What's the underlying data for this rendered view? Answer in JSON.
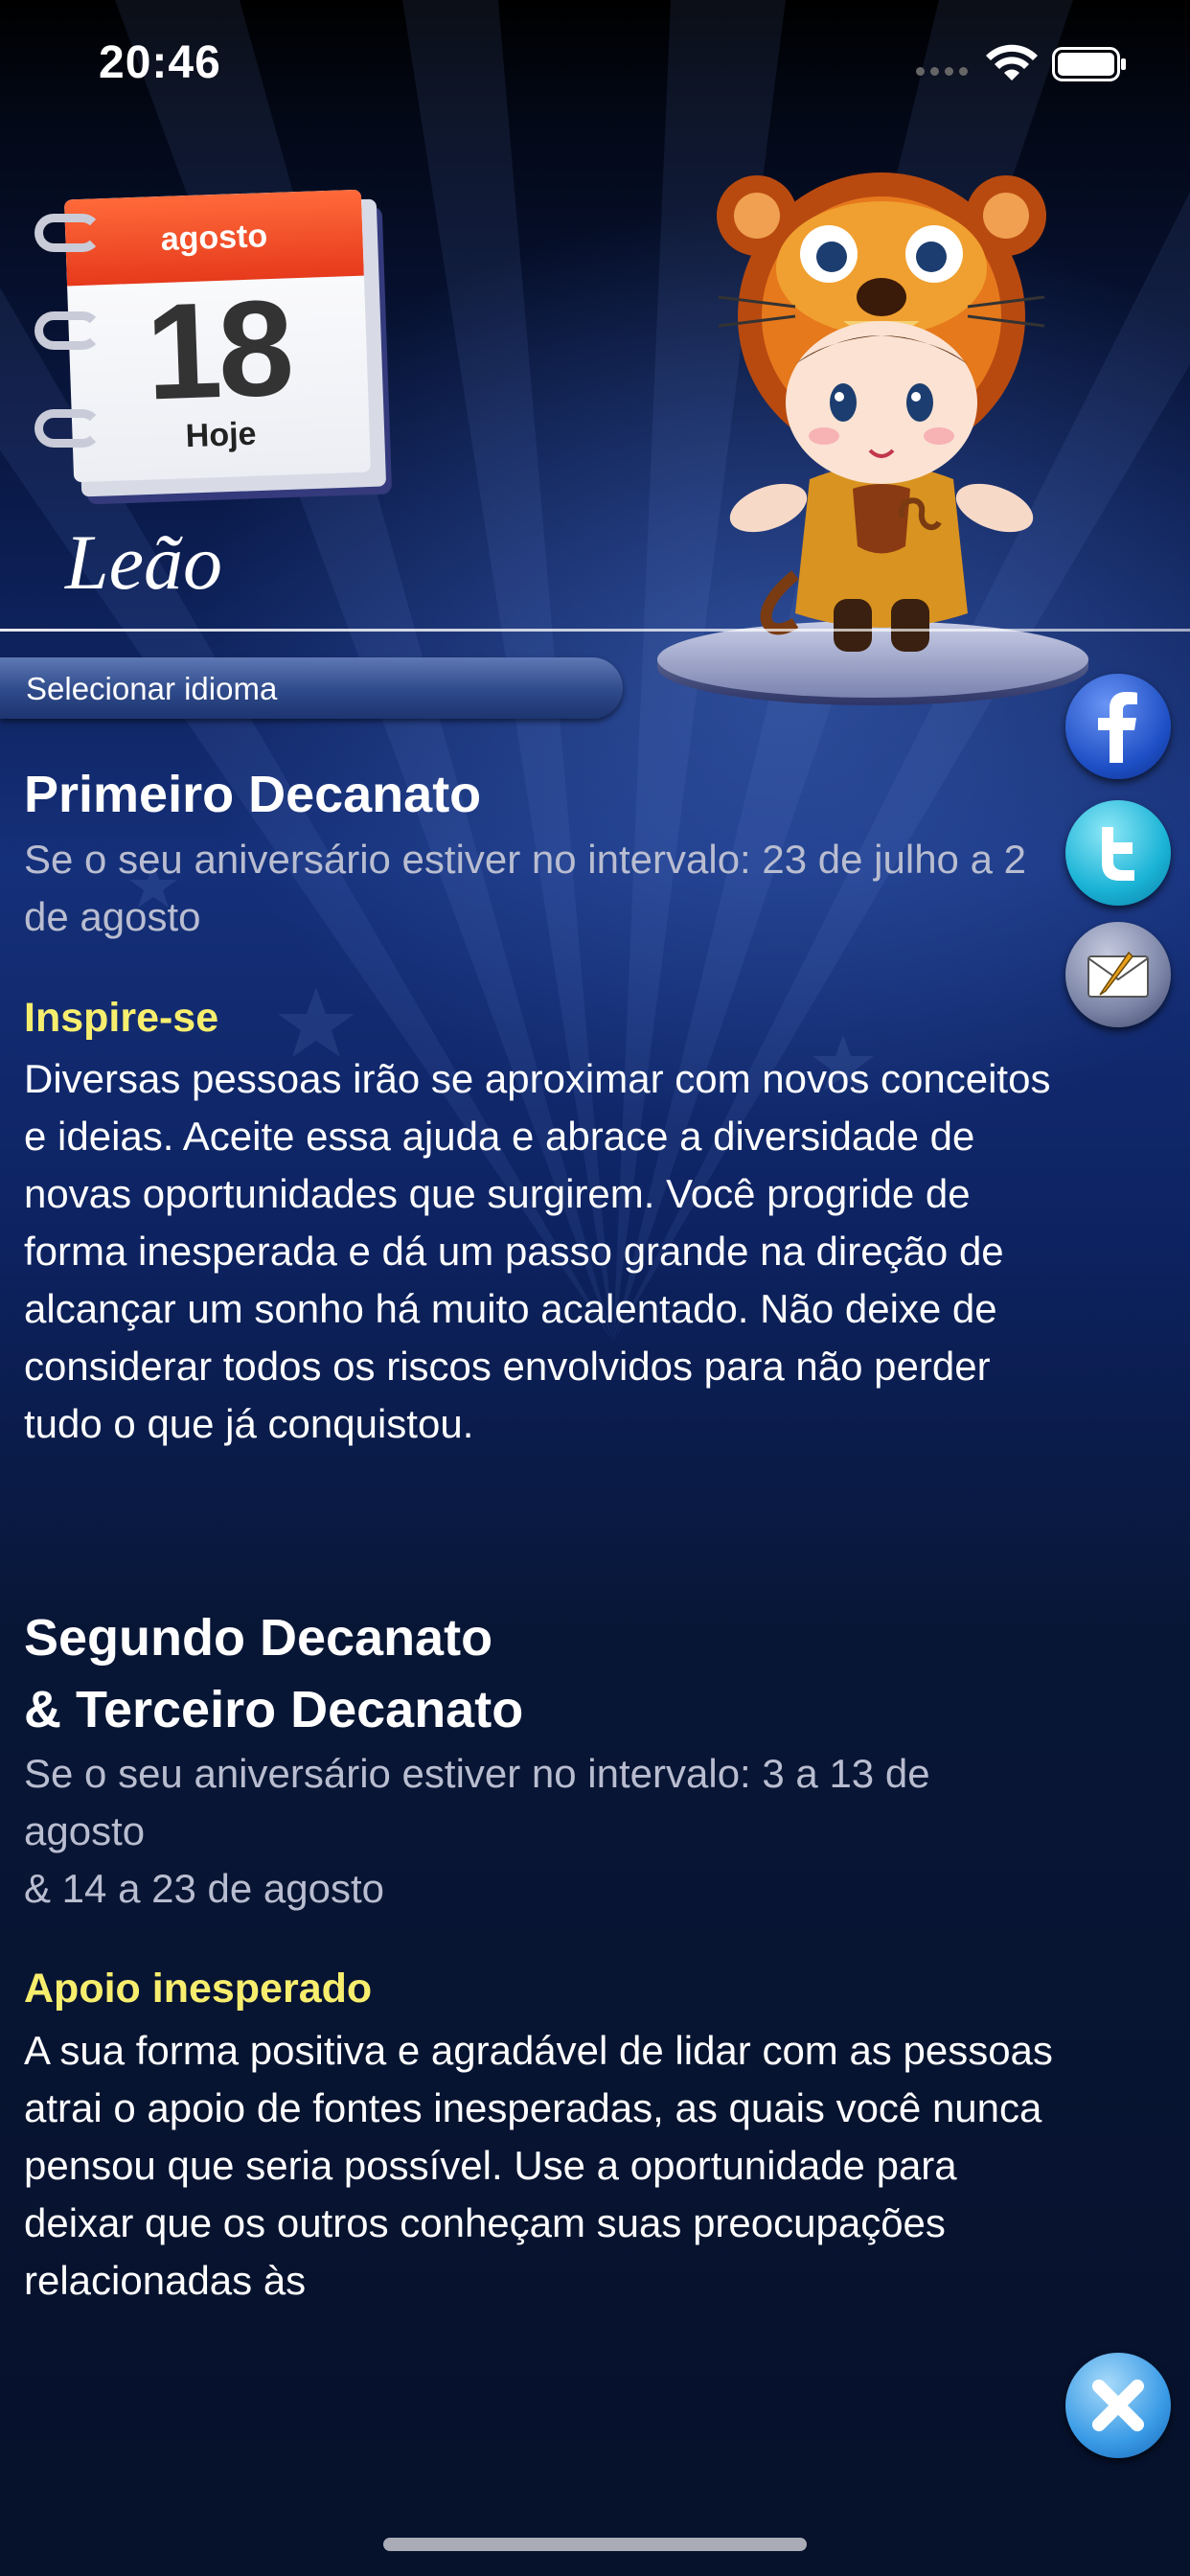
{
  "status_bar": {
    "time": "20:46"
  },
  "calendar": {
    "month": "agosto",
    "day": "18",
    "today_label": "Hoje"
  },
  "sign": {
    "name": "Leão"
  },
  "language_button": {
    "label": "Selecionar idioma"
  },
  "social": {
    "facebook_icon": "facebook-icon",
    "twitter_icon": "twitter-icon",
    "email_icon": "email-icon",
    "close_icon": "close-icon"
  },
  "sections": [
    {
      "title": "Primeiro Decanato",
      "range": "Se o seu aniversário estiver no intervalo: 23 de julho a 2 de agosto",
      "heading": "Inspire-se",
      "body": "Diversas pessoas irão se aproximar com novos conceitos e ideias. Aceite essa ajuda e abrace a diversidade de novas oportunidades que surgirem. Você progride de forma inesperada e dá um passo grande na direção de alcançar um sonho há muito acalentado. Não deixe de considerar todos os riscos envolvidos para não perder tudo o que já conquistou."
    },
    {
      "title_line1": "Segundo Decanato",
      "title_line2": "& Terceiro Decanato",
      "range_line1": "Se o seu aniversário estiver no intervalo: 3 a 13 de agosto",
      "range_line2": "& 14 a 23 de agosto",
      "heading": "Apoio inesperado",
      "body": "A sua forma positiva e agradável de lidar com as pessoas atrai o apoio de fontes inesperadas, as quais você nunca pensou que seria possível. Use a oportunidade para deixar que os outros conheçam suas preocupações relacionadas às"
    }
  ],
  "colors": {
    "heading_yellow": "#f8ee6e",
    "range_gray": "#b9bdd0",
    "background_navy": "#0a1a4a"
  }
}
